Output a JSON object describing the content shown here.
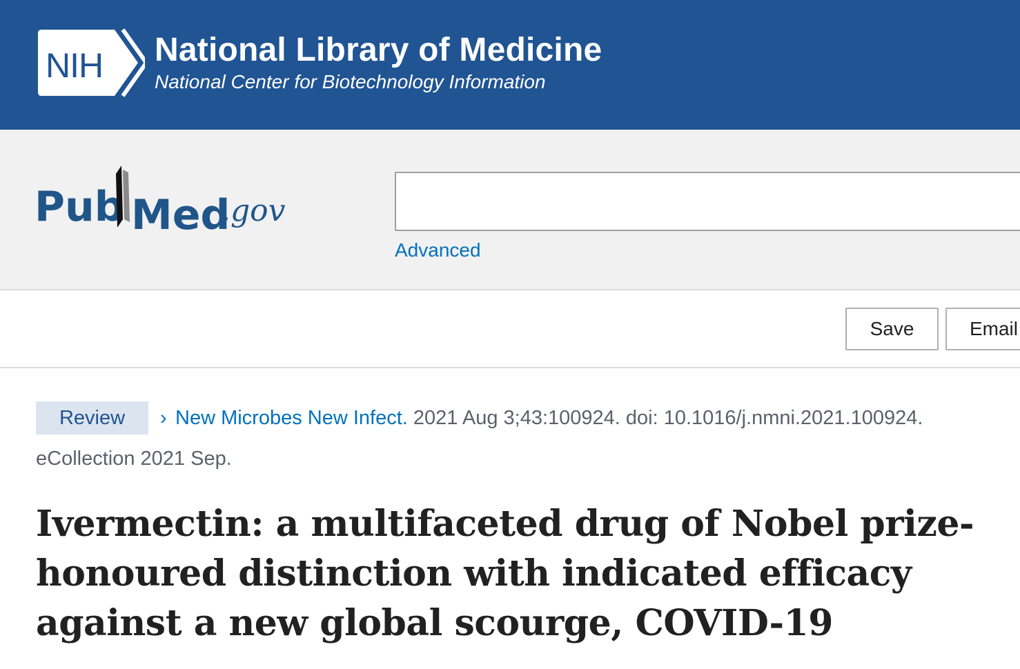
{
  "header": {
    "logo_text": "NIH",
    "title": "National Library of Medicine",
    "subtitle": "National Center for Biotechnology Information",
    "background_color": "#205493"
  },
  "search": {
    "logo_text_left": "Pub",
    "logo_text_right": "Med",
    "logo_suffix": ".gov",
    "query": "",
    "placeholder": "",
    "advanced_label": "Advanced"
  },
  "actions": {
    "save_label": "Save",
    "email_label": "Email"
  },
  "article": {
    "publication_type": "Review",
    "journal": "New Microbes New Infect.",
    "citation": " 2021 Aug 3;43:100924. doi: 10.1016/j.nmni.2021.100924.",
    "ecollection": "eCollection 2021 Sep.",
    "title": "Ivermectin: a multifaceted drug of Nobel prize-honoured distinction with indicated efficacy against a new global scourge, COVID-19"
  },
  "colors": {
    "link": "#0071bc",
    "pubmed_blue": "#20558a",
    "title_text": "#212121"
  }
}
